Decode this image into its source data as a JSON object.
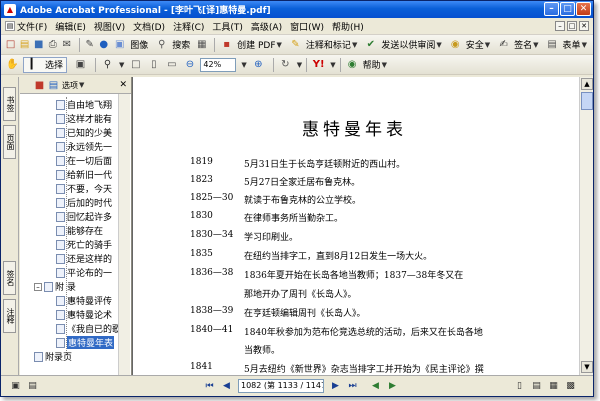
{
  "window": {
    "title": "Adobe Acrobat Professional - [李叶飞[译]惠特曼.pdf]",
    "app_icon": "acrobat-icon"
  },
  "menu": [
    {
      "label": "文件(F)"
    },
    {
      "label": "编辑(E)"
    },
    {
      "label": "视图(V)"
    },
    {
      "label": "文档(D)"
    },
    {
      "label": "注释(C)"
    },
    {
      "label": "工具(T)"
    },
    {
      "label": "高级(A)"
    },
    {
      "label": "窗口(W)"
    },
    {
      "label": "帮助(H)"
    }
  ],
  "toolbar1": {
    "image_label": "图像",
    "search_label": "搜索",
    "create_pdf_label": "创建 PDF",
    "comment_label": "注释和标记",
    "review_label": "发送以供审阅",
    "security_label": "安全",
    "sign_label": "签名",
    "forms_label": "表单"
  },
  "toolbar2": {
    "select_label": "选择",
    "zoom_value": "42%",
    "help_label": "帮助"
  },
  "side_tabs": [
    "书签",
    "页面",
    "签名",
    "注释"
  ],
  "nav": {
    "options_label": "选项",
    "items": [
      {
        "label": "自由地飞翔"
      },
      {
        "label": "这样才能有"
      },
      {
        "label": "已知的少美"
      },
      {
        "label": "永远领先一"
      },
      {
        "label": "在一切后面"
      },
      {
        "label": "给新旧一代"
      },
      {
        "label": "不要，今天"
      },
      {
        "label": "后加的时代"
      },
      {
        "label": "回忆起许多"
      },
      {
        "label": "能够存在"
      },
      {
        "label": "死亡的骑手"
      },
      {
        "label": "还是这样的"
      },
      {
        "label": "平论布的一"
      }
    ],
    "appendix": {
      "label": "附 录"
    },
    "appendix_items": [
      {
        "label": "惠特曼评传"
      },
      {
        "label": "惠特曼论术"
      },
      {
        "label": "《我自已的歌"
      },
      {
        "label": "惠特曼年表"
      }
    ],
    "appendix_page": {
      "label": "附录页"
    }
  },
  "document": {
    "title": "惠特曼年表",
    "entries": [
      {
        "year": "1819",
        "text": "5月31日生于长岛亨廷顿附近的西山村。"
      },
      {
        "year": "1823",
        "text": "5月27日全家迁居布鲁克林。"
      },
      {
        "year": "1825—30",
        "text": "就读于布鲁克林的公立学校。"
      },
      {
        "year": "1830",
        "text": "在律师事务所当勤杂工。"
      },
      {
        "year": "1830—34",
        "text": "学习印刷业。"
      },
      {
        "year": "1835",
        "text": "在纽约当排字工，直到8月12日发生一场大火。"
      },
      {
        "year": "1836—38",
        "text": "1836年夏开始在长岛各地当教师；1837—38年冬又在"
      },
      {
        "year": "",
        "text": "那地开办了周刊《长岛人》。"
      },
      {
        "year": "1838—39",
        "text": "在亨廷顿编辑周刊《长岛人》。"
      },
      {
        "year": "1840—41",
        "text": "1840年秋参加为范布伦竞选总统的活动，后来又在长岛各地"
      },
      {
        "year": "",
        "text": "当教师。"
      },
      {
        "year": "1841",
        "text": "5月去纽约《新世界》杂志当排字工并开始为《民主评论》撰"
      }
    ]
  },
  "status": {
    "page_indicator": "1082 (第 1133 / 1147 页)"
  }
}
